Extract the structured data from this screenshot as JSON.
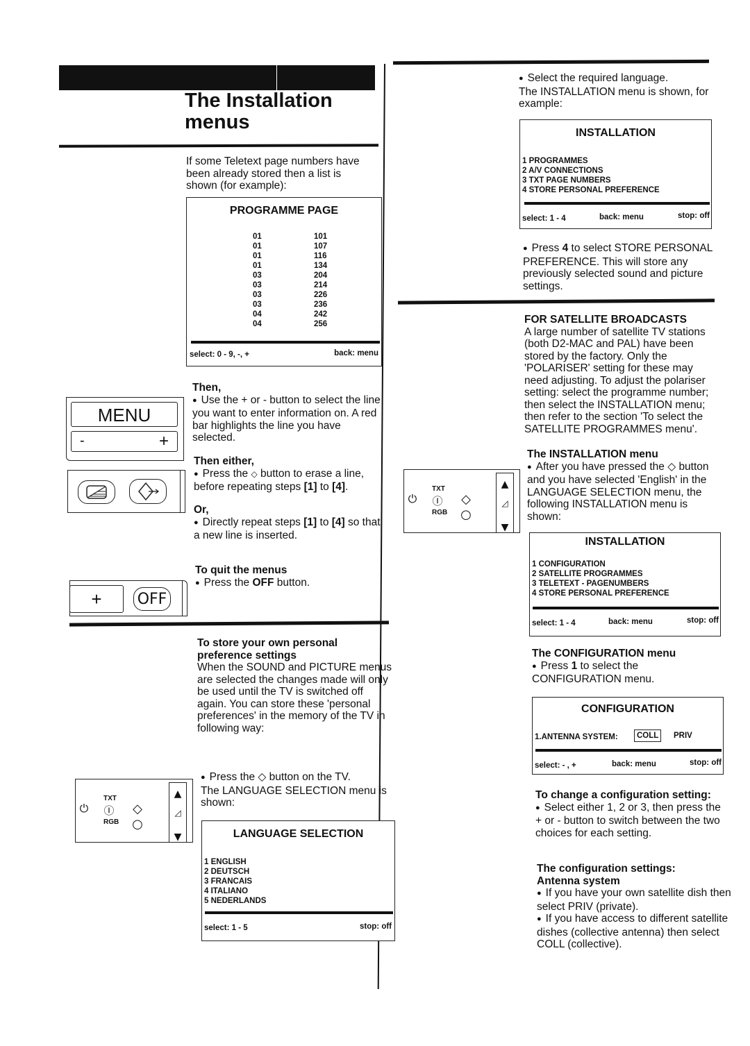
{
  "page": {
    "title_line1": "The Installation",
    "title_line2": "menus"
  },
  "left": {
    "intro": "If some Teletext page numbers have been already stored then a list is shown (for example):",
    "programme_page": {
      "title": "PROGRAMME PAGE",
      "rows": [
        {
          "prog": "01",
          "page": "101"
        },
        {
          "prog": "01",
          "page": "107"
        },
        {
          "prog": "01",
          "page": "116"
        },
        {
          "prog": "01",
          "page": "134"
        },
        {
          "prog": "03",
          "page": "204"
        },
        {
          "prog": "03",
          "page": "214"
        },
        {
          "prog": "03",
          "page": "226"
        },
        {
          "prog": "03",
          "page": "236"
        },
        {
          "prog": "04",
          "page": "242"
        },
        {
          "prog": "04",
          "page": "256"
        }
      ],
      "footer_left": "select: 0 - 9, -, +",
      "footer_right": "back: menu"
    },
    "remote_menu": {
      "menu_label": "MENU",
      "minus_label": "-",
      "plus_label": "+"
    },
    "then_heading": "Then,",
    "then_text": "Use the + or - button to select the line you want to enter information on. A red bar highlights the line you have selected.",
    "then_either_heading": "Then either,",
    "then_either_text_a": "Press the ",
    "then_either_glyph": "◇",
    "then_either_text_b": " button to erase a line, before repeating steps ",
    "step1": "[1]",
    "to": " to ",
    "step4": "[4]",
    "period": ".",
    "or_heading": "Or,",
    "or_text_a": "Directly repeat steps ",
    "or_text_b": " so that a new line is inserted.",
    "remote_off": {
      "plus_label": "+",
      "off_label": "OFF"
    },
    "quit_heading": "To quit the menus",
    "quit_text_a": "Press the ",
    "quit_text_bold": "OFF",
    "quit_text_b": " button.",
    "store_heading": "To store your own personal preference settings",
    "store_text": "When the SOUND and PICTURE menus are selected the changes made will only be used until the TV is switched off again. You can store these 'personal preferences' in the memory of the TV in following way:",
    "tv_panel": {
      "txt_label": "TXT",
      "rgb_label": "RGB"
    },
    "press_text": "Press the ◇ button on the TV.",
    "press_text2": "The LANGUAGE SELECTION menu is shown:",
    "language_selection": {
      "title": "LANGUAGE SELECTION",
      "items": [
        "1 ENGLISH",
        "2 DEUTSCH",
        "3 FRANCAIS",
        "4 ITALIANO",
        "5 NEDERLANDS"
      ],
      "footer_left": "select: 1 - 5",
      "footer_right": "stop: off"
    }
  },
  "right": {
    "select_lang_text": "Select the required language.",
    "install_shown_text": "The INSTALLATION menu is shown, for example:",
    "installation_a": {
      "title": "INSTALLATION",
      "items": [
        "1 PROGRAMMES",
        "2 A/V CONNECTIONS",
        "3 TXT PAGE NUMBERS",
        "4 STORE PERSONAL PREFERENCE"
      ],
      "footer_left": "select: 1 - 4",
      "footer_mid": "back: menu",
      "footer_right": "stop: off"
    },
    "press4_a": "Press ",
    "press4_bold": "4",
    "press4_b": " to select STORE PERSONAL PREFERENCE. This will store any previously selected sound and picture settings.",
    "satellite_heading": "FOR SATELLITE BROADCASTS",
    "satellite_text": "A large number of satellite TV stations (both D2-MAC and PAL) have been stored by the factory. Only the 'POLARISER' setting for these may need adjusting. To adjust the polariser setting: select the programme number; then select the INSTALLATION menu; then refer to the section 'To select the SATELLITE PROGRAMMES menu'.",
    "tv_panel": {
      "txt_label": "TXT",
      "rgb_label": "RGB"
    },
    "install_menu_heading": "The INSTALLATION menu",
    "install_menu_text": "After you have pressed the ◇ button and you have selected 'English' in the LANGUAGE SELECTION menu, the following INSTALLATION menu is shown:",
    "installation_b": {
      "title": "INSTALLATION",
      "items": [
        "1 CONFIGURATION",
        "2 SATELLITE PROGRAMMES",
        "3 TELETEXT - PAGENUMBERS",
        "4 STORE PERSONAL PREFERENCE"
      ],
      "footer_left": "select: 1 - 4",
      "footer_mid": "back: menu",
      "footer_right": "stop: off"
    },
    "config_heading": "The CONFIGURATION menu",
    "config_text_a": "Press ",
    "config_text_bold": "1",
    "config_text_b": " to select the CONFIGURATION menu.",
    "configuration": {
      "title": "CONFIGURATION",
      "row_label": "1.ANTENNA SYSTEM:",
      "option_selected": "COLL",
      "option_other": "PRIV",
      "footer_left": "select: - , +",
      "footer_mid": "back: menu",
      "footer_right": "stop: off"
    },
    "change_heading": "To change a configuration setting:",
    "change_text": "Select either 1, 2 or 3, then press the + or - button to switch between the two choices for each setting.",
    "settings_heading": "The configuration settings:",
    "antenna_heading": "Antenna system",
    "antenna_text1": "If you have your own satellite dish then select PRIV (private).",
    "antenna_text2": "If you have access to different satellite dishes (collective antenna) then select COLL (collective)."
  }
}
